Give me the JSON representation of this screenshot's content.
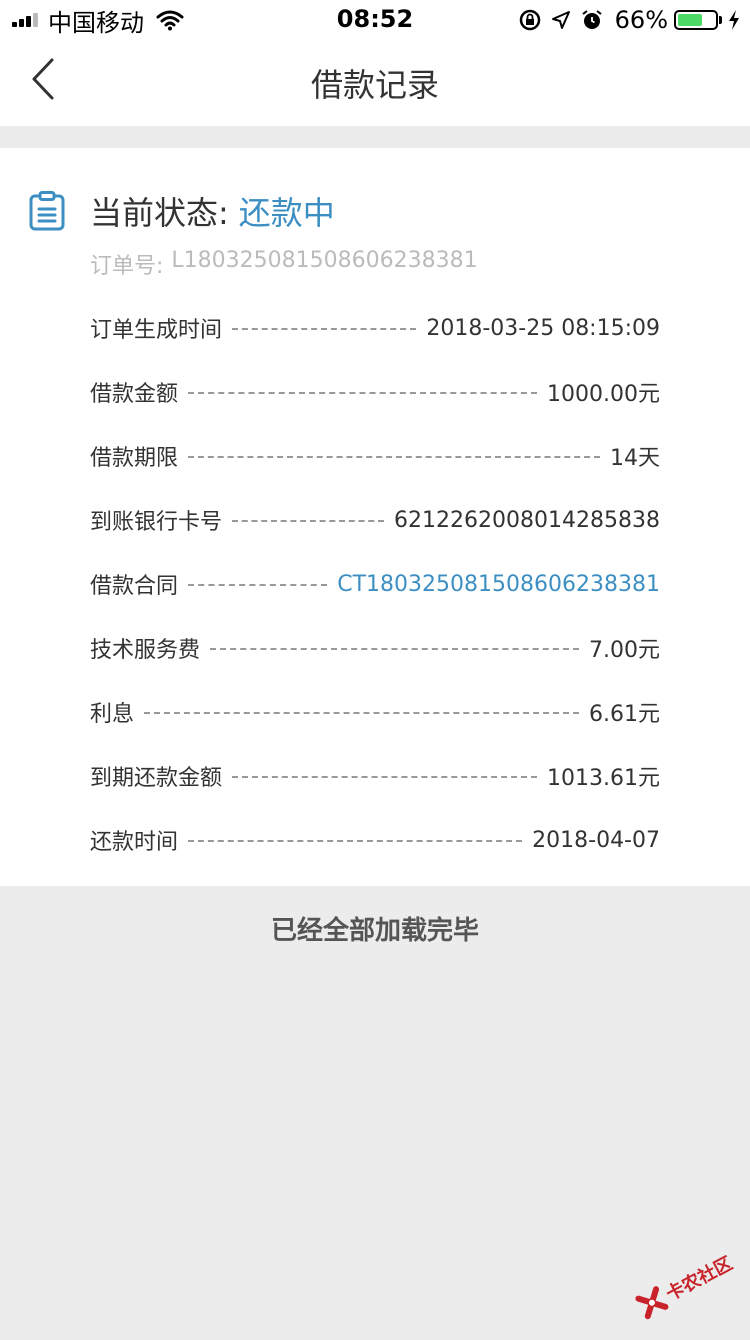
{
  "status_bar": {
    "carrier": "中国移动",
    "time": "08:52",
    "battery_percent": "66%",
    "battery_level": 0.66
  },
  "nav": {
    "title": "借款记录"
  },
  "record": {
    "status_label": "当前状态:",
    "status_value": "还款中",
    "order_label": "订单号:",
    "order_value": "L180325081508606238381",
    "rows": [
      {
        "label": "订单生成时间",
        "value": "2018-03-25 08:15:09",
        "link": false
      },
      {
        "label": "借款金额",
        "value": "1000.00元",
        "link": false
      },
      {
        "label": "借款期限",
        "value": "14天",
        "link": false
      },
      {
        "label": "到账银行卡号",
        "value": "6212262008014285838",
        "link": false
      },
      {
        "label": "借款合同",
        "value": "CT180325081508606238381",
        "link": true
      },
      {
        "label": "技术服务费",
        "value": "7.00元",
        "link": false
      },
      {
        "label": "利息",
        "value": "6.61元",
        "link": false
      },
      {
        "label": "到期还款金额",
        "value": "1013.61元",
        "link": false
      },
      {
        "label": "还款时间",
        "value": "2018-04-07",
        "link": false
      }
    ]
  },
  "footer": {
    "text": "已经全部加载完毕"
  },
  "watermark": {
    "text": "卡农社区"
  },
  "colors": {
    "accent": "#3d8fc3",
    "battery": "#4cd964",
    "background": "#ececec"
  }
}
